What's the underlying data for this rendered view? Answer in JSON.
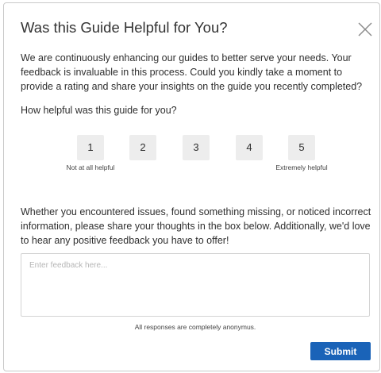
{
  "dialog": {
    "title": "Was this Guide Helpful for You?",
    "close_icon": "close-icon",
    "intro": "We are continuously enhancing our guides to better serve your needs. Your feedback is invaluable in this process. Could you kindly take a moment to provide a rating and share your insights on the guide you recently completed?",
    "question": "How helpful was this guide for you?",
    "rating": {
      "options": [
        {
          "label": "1",
          "caption": "Not at all helpful"
        },
        {
          "label": "2",
          "caption": ""
        },
        {
          "label": "3",
          "caption": ""
        },
        {
          "label": "4",
          "caption": ""
        },
        {
          "label": "5",
          "caption": "Extremely helpful"
        }
      ]
    },
    "details": "Whether you encountered issues, found something missing, or noticed incorrect information, please share your thoughts in the box below. Additionally, we'd love to hear any positive feedback you have to offer!",
    "feedback": {
      "placeholder": "Enter feedback here...",
      "value": ""
    },
    "anonymous_note": "All responses are completely anonymus.",
    "submit_label": "Submit"
  },
  "colors": {
    "submit_background": "#1a63b8",
    "rating_background": "#ededed",
    "border": "#c9c9c9"
  }
}
